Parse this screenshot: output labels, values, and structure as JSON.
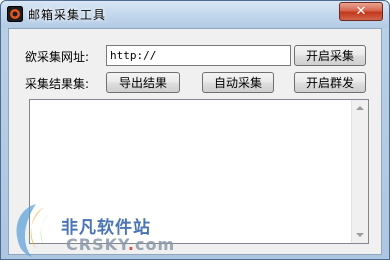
{
  "window": {
    "title": "邮箱采集工具",
    "close_glyph": "✕"
  },
  "form": {
    "url_label": "欲采集网址:",
    "url_value": "http://",
    "start_collect_label": "开启采集",
    "result_label": "采集结果集:",
    "export_label": "导出结果",
    "auto_collect_label": "自动采集",
    "start_send_label": "开启群发"
  },
  "output": {
    "text": ""
  },
  "watermark": {
    "cn_text": "非凡软件站",
    "en_text_a": "CRSKY",
    "en_text_dot": ".",
    "en_text_b": "com"
  },
  "colors": {
    "title_bg": "#c3d7ec",
    "close_red": "#c2371c",
    "client_bg": "#f0f0f0",
    "watermark_blue": "#2b5ea8"
  }
}
